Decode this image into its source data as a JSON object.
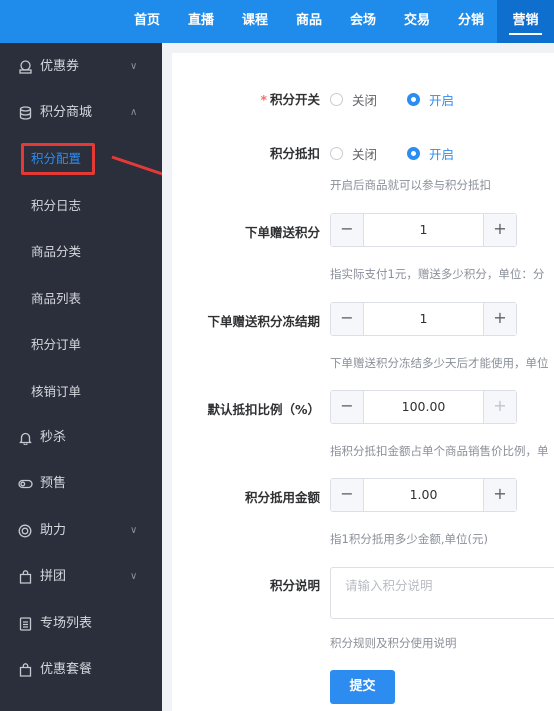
{
  "topnav": {
    "items": [
      {
        "label": "首页"
      },
      {
        "label": "直播"
      },
      {
        "label": "课程"
      },
      {
        "label": "商品"
      },
      {
        "label": "会场"
      },
      {
        "label": "交易"
      },
      {
        "label": "分销"
      },
      {
        "label": "营销"
      }
    ],
    "active": "营销"
  },
  "sidebar": {
    "coupon": {
      "label": "优惠券",
      "icon": "coupon-icon"
    },
    "points_mall": {
      "label": "积分商城",
      "icon": "database-icon"
    },
    "sub": [
      {
        "label": "积分配置"
      },
      {
        "label": "积分日志"
      },
      {
        "label": "商品分类"
      },
      {
        "label": "商品列表"
      },
      {
        "label": "积分订单"
      },
      {
        "label": "核销订单"
      }
    ],
    "seckill": {
      "label": "秒杀",
      "icon": "bell-icon"
    },
    "presale": {
      "label": "预售",
      "icon": "toggle-icon"
    },
    "assist": {
      "label": "助力",
      "icon": "lifebuoy-icon"
    },
    "groupbuy": {
      "label": "拼团",
      "icon": "bag-icon"
    },
    "venue_list": {
      "label": "专场列表",
      "icon": "list-icon"
    },
    "bundle": {
      "label": "优惠套餐",
      "icon": "bag-icon"
    }
  },
  "form": {
    "points_switch": {
      "label": "积分开关",
      "required_mark": "*",
      "off": "关闭",
      "on": "开启",
      "selected": "开启"
    },
    "points_deduct": {
      "label": "积分抵扣",
      "off": "关闭",
      "on": "开启",
      "selected": "开启",
      "hint": "开启后商品就可以参与积分抵扣"
    },
    "order_gift_points": {
      "label": "下单赠送积分",
      "value": "1",
      "hint": "指实际支付1元，赠送多少积分，单位：分"
    },
    "gift_freeze": {
      "label": "下单赠送积分冻结期",
      "value": "1",
      "hint": "下单赠送积分冻结多少天后才能使用，单位"
    },
    "default_ratio": {
      "label": "默认抵扣比例（%）",
      "value": "100.00",
      "hint": "指积分抵扣金额占单个商品销售价比例，单"
    },
    "points_amount": {
      "label": "积分抵用金额",
      "value": "1.00",
      "hint": "指1积分抵用多少金额,单位(元)"
    },
    "points_desc": {
      "label": "积分说明",
      "placeholder": "请输入积分说明",
      "hint": "积分规则及积分使用说明"
    },
    "submit_label": "提交"
  },
  "colors": {
    "primary": "#2d8cf0",
    "topbar": "#1f8ceb",
    "sidebar_bg": "#2a2f3b",
    "annotation": "#e53935"
  }
}
